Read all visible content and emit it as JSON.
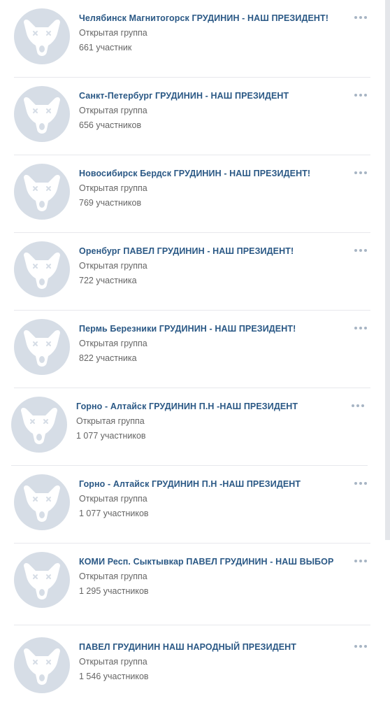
{
  "icons": {
    "avatar": "vk-dog-placeholder-icon",
    "more": "more-horizontal-icon"
  },
  "colors": {
    "name": "#2a5885",
    "secondary": "#656565",
    "avatar_bg": "#d6dde6",
    "dots": "#a7b5c4"
  },
  "groups": [
    {
      "name": "Челябинск Магнитогорск ГРУДИНИН - НАШ ПРЕЗИДЕНТ!",
      "type": "Открытая группа",
      "members": "661 участник"
    },
    {
      "name": "Санкт-Петербург ГРУДИНИН - НАШ ПРЕЗИДЕНТ",
      "type": "Открытая группа",
      "members": "656 участников"
    },
    {
      "name": "Новосибирск Бердск ГРУДИНИН - НАШ ПРЕЗИДЕНТ!",
      "type": "Открытая группа",
      "members": "769 участников"
    },
    {
      "name": "Оренбург ПАВЕЛ ГРУДИНИН - НАШ ПРЕЗИДЕНТ!",
      "type": "Открытая группа",
      "members": "722 участника"
    },
    {
      "name": "Пермь Березники ГРУДИНИН - НАШ ПРЕЗИДЕНТ!",
      "type": "Открытая группа",
      "members": "822 участника"
    },
    {
      "name": "Горно - Алтайск ГРУДИНИН П.Н -НАШ ПРЕЗИДЕНТ",
      "type": "Открытая группа",
      "members": "1 077 участников"
    },
    {
      "name": "Горно - Алтайск ГРУДИНИН П.Н -НАШ ПРЕЗИДЕНТ",
      "type": "Открытая группа",
      "members": "1 077 участников"
    },
    {
      "name": "КОМИ Респ. Сыктывкар ПАВЕЛ ГРУДИНИН - НАШ ВЫБОР",
      "type": "Открытая группа",
      "members": "1 295 участников"
    },
    {
      "name": "ПАВЕЛ ГРУДИНИН НАШ НАРОДНЫЙ ПРЕЗИДЕНТ",
      "type": "Открытая группа",
      "members": "1 546 участников"
    }
  ]
}
